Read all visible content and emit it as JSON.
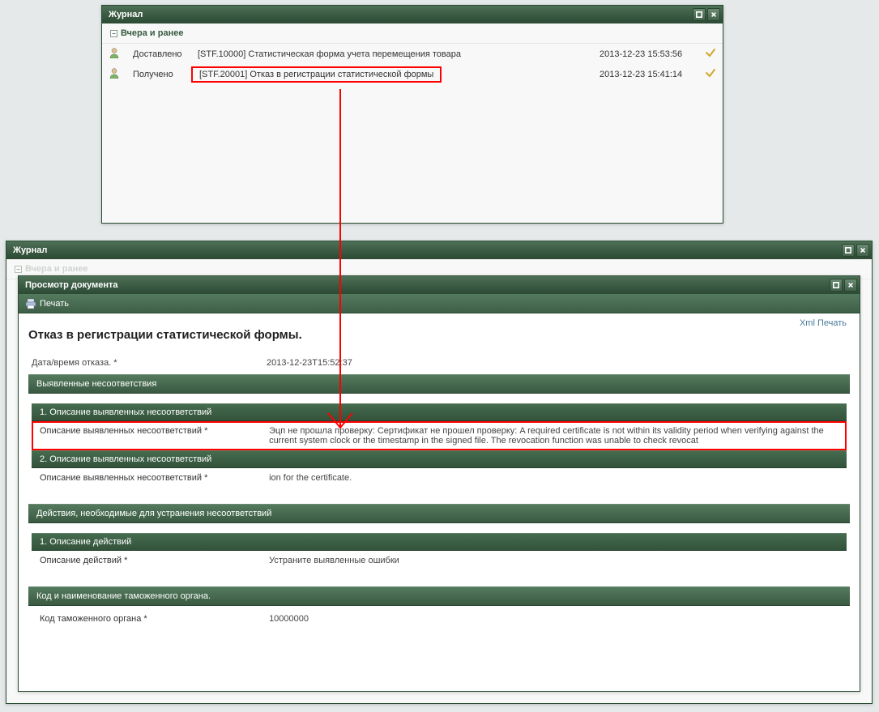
{
  "top_window": {
    "title": "Журнал",
    "group_label": "Вчера и ранее",
    "rows": [
      {
        "status": "Доставлено",
        "subject": "[STF.10000] Статистическая форма учета перемещения товара",
        "time": "2013-12-23 15:53:56"
      },
      {
        "status": "Получено",
        "subject": "[STF.20001] Отказ в регистрации статистической формы",
        "time": "2013-12-23 15:41:14"
      }
    ]
  },
  "bottom_window": {
    "title": "Журнал",
    "group_label": "Вчера и ранее",
    "viewer_title": "Просмотр документа",
    "print_label": "Печать",
    "xml_link": "Xml Печать",
    "doc_title": "Отказ в регистрации статистической формы.",
    "datetime_label": "Дата/время отказа. *",
    "datetime_value": "2013-12-23T15:52:37",
    "issues_header": "Выявленные несоответствия",
    "issue1_header": "1. Описание выявленных несоответствий",
    "issue_label": "Описание выявленных несоответствий *",
    "issue1_value": "Эцп не прошла проверку: Сертификат не прошел проверку: A required certificate is not within its validity period when verifying against the current system clock or the timestamp in the signed file. The revocation function was unable to check revocat",
    "issue2_header": "2. Описание выявленных несоответствий",
    "issue2_value": "ion for the certificate.",
    "actions_header": "Действия, необходимые для устранения несоответствий",
    "action1_header": "1. Описание действий",
    "action_label": "Описание действий *",
    "action_value": "Устраните выявленные ошибки",
    "customs_header": "Код и наименование таможенного органа.",
    "customs_label": "Код таможенного органа *",
    "customs_value": "10000000"
  }
}
